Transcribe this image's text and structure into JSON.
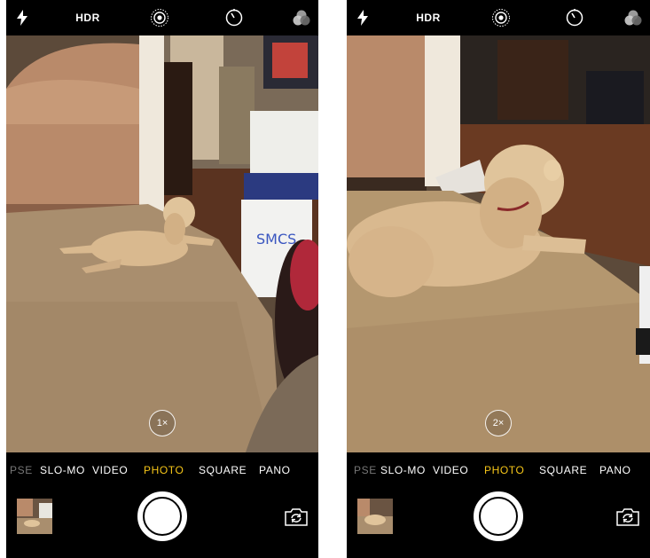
{
  "screens": [
    {
      "top_bar": {
        "hdr": "HDR"
      },
      "zoom": "1×",
      "modes": [
        "PSE",
        "SLO-MO",
        "VIDEO",
        "PHOTO",
        "SQUARE",
        "PANO"
      ],
      "active_mode": "PHOTO"
    },
    {
      "top_bar": {
        "hdr": "HDR"
      },
      "zoom": "2×",
      "modes": [
        "PSE",
        "SLO-MO",
        "VIDEO",
        "PHOTO",
        "SQUARE",
        "PANO"
      ],
      "active_mode": "PHOTO"
    }
  ],
  "icons": {
    "flash": "flash-icon",
    "live_photo": "live-photo-icon",
    "timer": "timer-icon",
    "filters": "filters-icon",
    "switch_camera": "switch-camera-icon"
  },
  "colors": {
    "active_mode": "#f5c518",
    "background": "#000000",
    "carpet": "#a98e6e",
    "dog": "#d9b98f"
  }
}
